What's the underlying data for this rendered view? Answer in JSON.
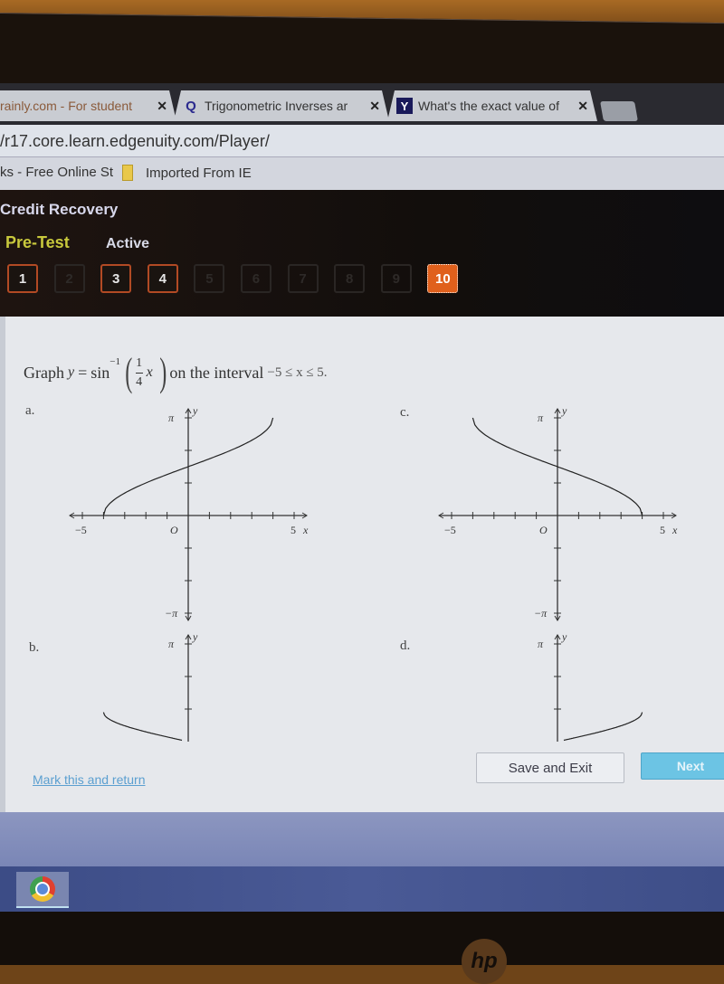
{
  "browser": {
    "tabs": [
      {
        "label": "rainly.com - For student",
        "icon": "brainly-icon",
        "close": "✕"
      },
      {
        "label": "Trigonometric Inverses ar",
        "icon": "q-icon",
        "icon_glyph": "Q",
        "close": "✕"
      },
      {
        "label": "What's the exact value of",
        "icon": "yahoo-icon",
        "icon_glyph": "Y",
        "close": "✕"
      }
    ],
    "url": "/r17.core.learn.edgenuity.com/Player/",
    "bookmarks": [
      {
        "label": "ks - Free Online St"
      },
      {
        "label": "Imported From IE",
        "icon": "folder-icon"
      }
    ]
  },
  "app": {
    "course_title": "Credit Recovery",
    "section": "Pre-Test",
    "status": "Active",
    "question_nav": [
      {
        "label": "1",
        "state": "answered"
      },
      {
        "label": "2",
        "state": "disabled"
      },
      {
        "label": "3",
        "state": "answered"
      },
      {
        "label": "4",
        "state": "answered"
      },
      {
        "label": "5",
        "state": "disabled"
      },
      {
        "label": "6",
        "state": "disabled"
      },
      {
        "label": "7",
        "state": "disabled"
      },
      {
        "label": "8",
        "state": "disabled"
      },
      {
        "label": "9",
        "state": "disabled"
      },
      {
        "label": "10",
        "state": "current"
      }
    ],
    "colors": {
      "accent": "#e0601c",
      "section": "#c8c83c",
      "next": "#6cc4e4",
      "link": "#5b9fd0"
    }
  },
  "question": {
    "prefix": "Graph",
    "y": "y",
    "equals": "=",
    "func": "sin",
    "exponent": "−1",
    "frac_num": "1",
    "frac_den": "4",
    "x": "x",
    "suffix": "on the interval",
    "interval": "−5 ≤ x ≤ 5."
  },
  "options": [
    {
      "label": "a.",
      "curve": "from (−4, 0) rising through (0, π/2) to (4, π)"
    },
    {
      "label": "b.",
      "curve": "from (−4, π/2·?) falling toward (0, 0) – partially visible"
    },
    {
      "label": "c.",
      "curve": "from (−4, π) falling through (0, π/2) to (4, 0)"
    },
    {
      "label": "d.",
      "curve": "from (0, 0) rising toward (4, ·) – partially visible"
    }
  ],
  "axes": {
    "x_min_label": "−5",
    "x_max_label": "5",
    "x_label": "x",
    "y_max_label": "π",
    "y_min_label": "−π",
    "y_label": "y",
    "origin_label": "O"
  },
  "footer": {
    "mark_link": "Mark this and return",
    "save_exit": "Save and Exit",
    "next": "Next"
  },
  "taskbar": {
    "apps": [
      {
        "name": "chrome"
      }
    ]
  },
  "device": {
    "brand": "hp"
  }
}
